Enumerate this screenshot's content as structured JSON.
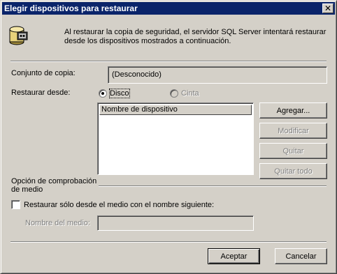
{
  "window": {
    "title": "Elegir dispositivos para restaurar",
    "close_glyph": "✕"
  },
  "info": {
    "icon": "tape-database-icon",
    "text_line1": "Al restaurar la copia de seguridad, el servidor SQL Server intentará restaurar",
    "text_line2": "desde los dispositivos mostrados a continuación."
  },
  "backup_set": {
    "label": "Conjunto de copia:",
    "value": "(Desconocido)"
  },
  "restore_from": {
    "label": "Restaurar desde:",
    "options": [
      {
        "label": "Disco",
        "selected": true,
        "enabled": true
      },
      {
        "label": "Cinta",
        "selected": false,
        "enabled": false
      }
    ]
  },
  "device_list": {
    "column_header": "Nombre de dispositivo",
    "rows": []
  },
  "buttons": {
    "add": "Agregar...",
    "modify": "Modificar",
    "remove": "Quitar",
    "remove_all": "Quitar todo",
    "accept": "Aceptar",
    "cancel": "Cancelar"
  },
  "media_check": {
    "section_line1": "Opción de comprobación",
    "section_line2": "de medio",
    "checkbox_label": "Restaurar sólo desde el medio con el nombre siguiente:",
    "checked": false,
    "media_name_label": "Nombre del medio:",
    "media_name_value": ""
  },
  "colors": {
    "face": "#d4d0c8",
    "titlebar": "#0a246a",
    "disabled_text": "#808080"
  }
}
